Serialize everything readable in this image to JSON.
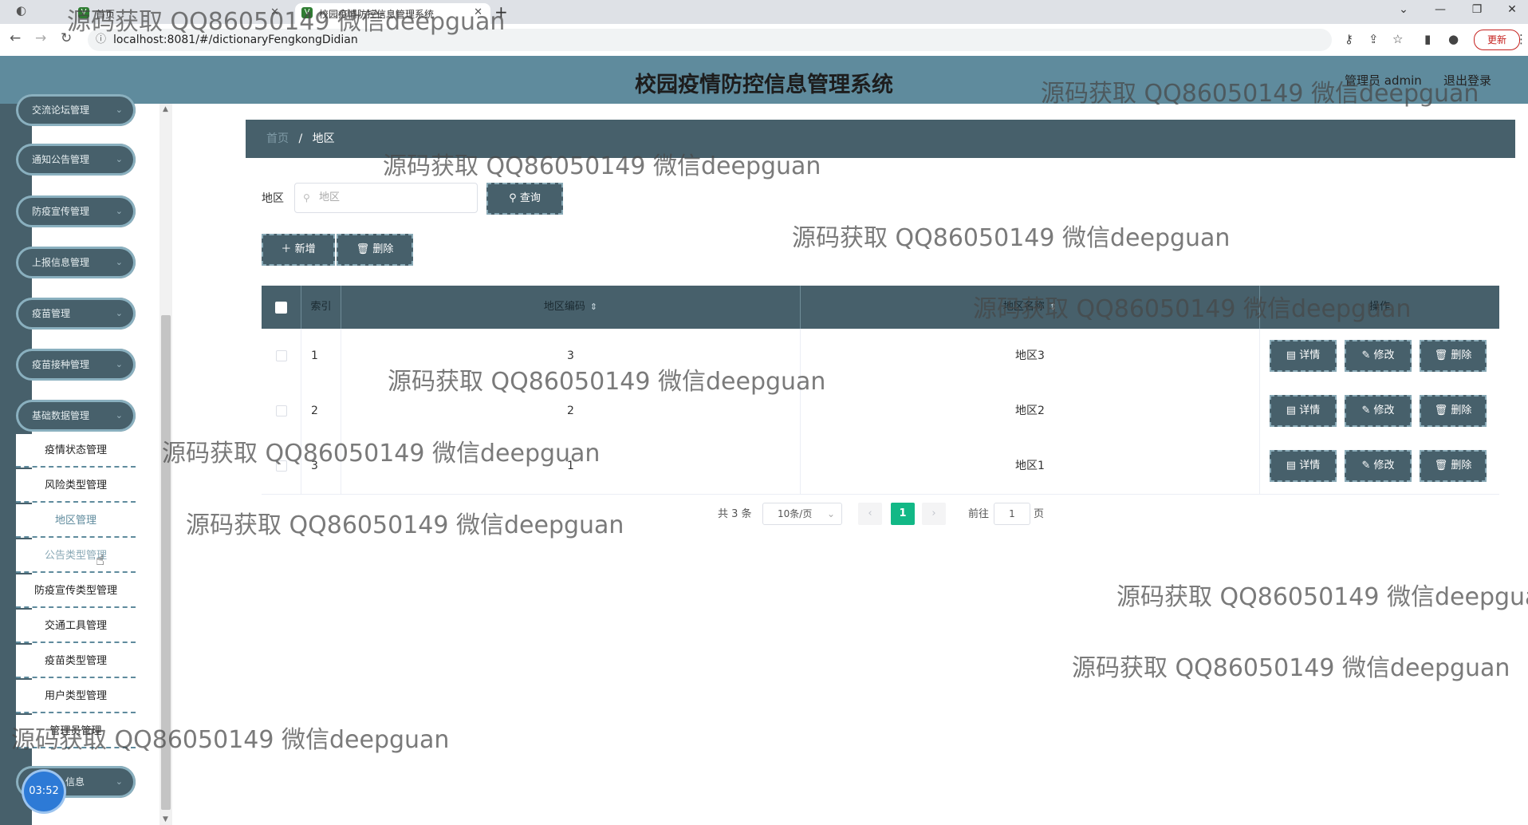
{
  "browser": {
    "tab1_title": "首页",
    "tab2_title": "校园疫情防控信息管理系统",
    "url": "localhost:8081/#/dictionaryFengkongDidian",
    "update_label": "更新"
  },
  "header": {
    "title": "校园疫情防控信息管理系统",
    "user": "管理员 admin",
    "logout": "退出登录"
  },
  "sidebar": {
    "menus": [
      "交流论坛管理",
      "通知公告管理",
      "防疫宣传管理",
      "上报信息管理",
      "疫苗管理",
      "疫苗接种管理",
      "基础数据管理"
    ],
    "submenu": [
      "疫情状态管理",
      "风险类型管理",
      "地区管理",
      "公告类型管理",
      "防疫宣传类型管理",
      "交通工具管理",
      "疫苗类型管理",
      "用户类型管理",
      "管理员管理"
    ],
    "bottom_menu": "信息",
    "timer": "03:52"
  },
  "breadcrumb": {
    "home": "首页",
    "sep": "/",
    "current": "地区"
  },
  "search": {
    "label": "地区",
    "placeholder": "地区",
    "query_btn": "查询",
    "add_btn": "新增",
    "delete_btn": "删除"
  },
  "table": {
    "headers": [
      "索引",
      "地区编码",
      "地区名称",
      "操作"
    ],
    "rows": [
      {
        "index": "1",
        "code": "3",
        "name": "地区3"
      },
      {
        "index": "2",
        "code": "2",
        "name": "地区2"
      },
      {
        "index": "3",
        "code": "1",
        "name": "地区1"
      }
    ],
    "actions": {
      "detail": "详情",
      "edit": "修改",
      "delete": "删除"
    }
  },
  "pagination": {
    "total": "共 3 条",
    "page_size": "10条/页",
    "current_page": "1",
    "goto_label": "前往",
    "goto_value": "1",
    "page_suffix": "页"
  },
  "watermark": "源码获取 QQ86050149 微信deepguan",
  "watermark_cut": "源码获取 QQ86050149 微信deepgua"
}
